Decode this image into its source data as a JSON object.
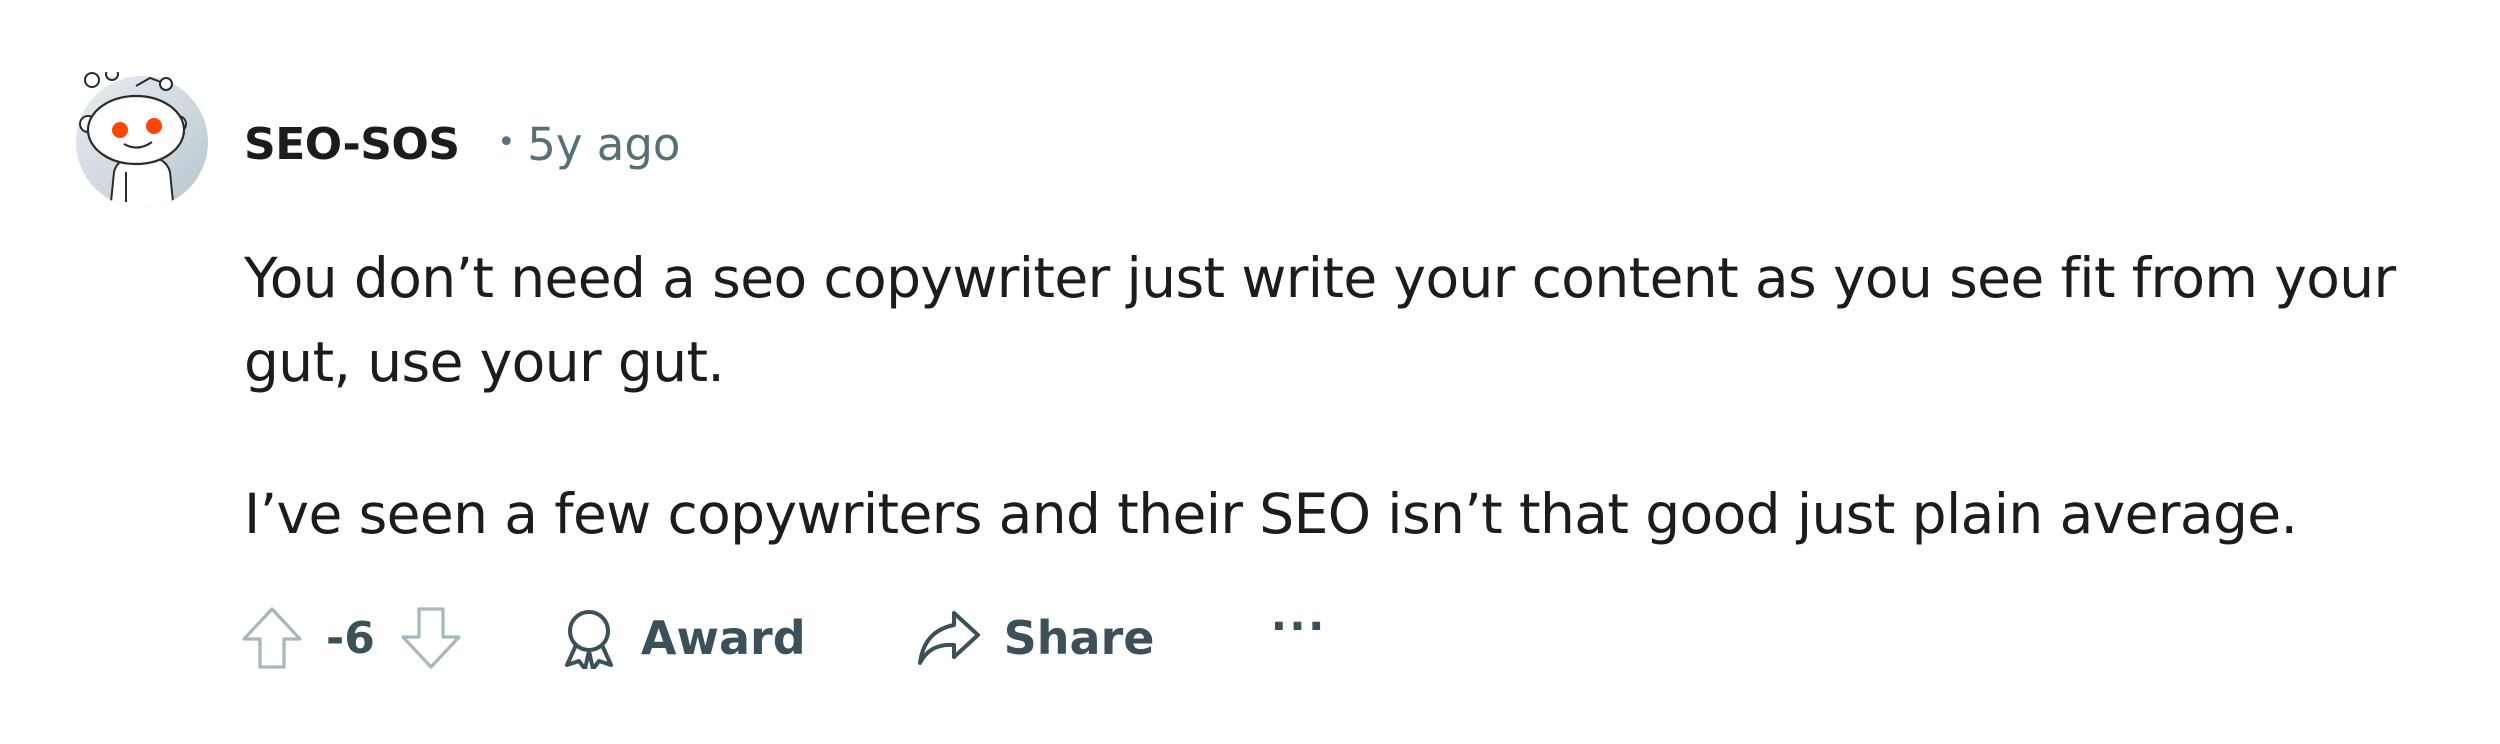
{
  "comment": {
    "author": "SEO-SOS",
    "separator": "•",
    "time": "5y ago",
    "paragraphs": [
      "You don’t need a seo copywriter just write your content as you see fit from your gut, use your gut.",
      "I’ve seen a few copywriters and their SEO isn’t that good just plain average."
    ]
  },
  "actions": {
    "score": "-6",
    "award_label": "Award",
    "share_label": "Share",
    "more_label": "···"
  },
  "icons": {
    "avatar": "snoo-avatar-icon",
    "upvote": "arrow-up-icon",
    "downvote": "arrow-down-icon",
    "award": "award-ribbon-icon",
    "share": "share-arrow-icon",
    "more": "ellipsis-icon"
  },
  "colors": {
    "text": "#1c1c1c",
    "meta": "#576f76",
    "action": "#3c5059",
    "snoo_eye": "#ff4500"
  }
}
